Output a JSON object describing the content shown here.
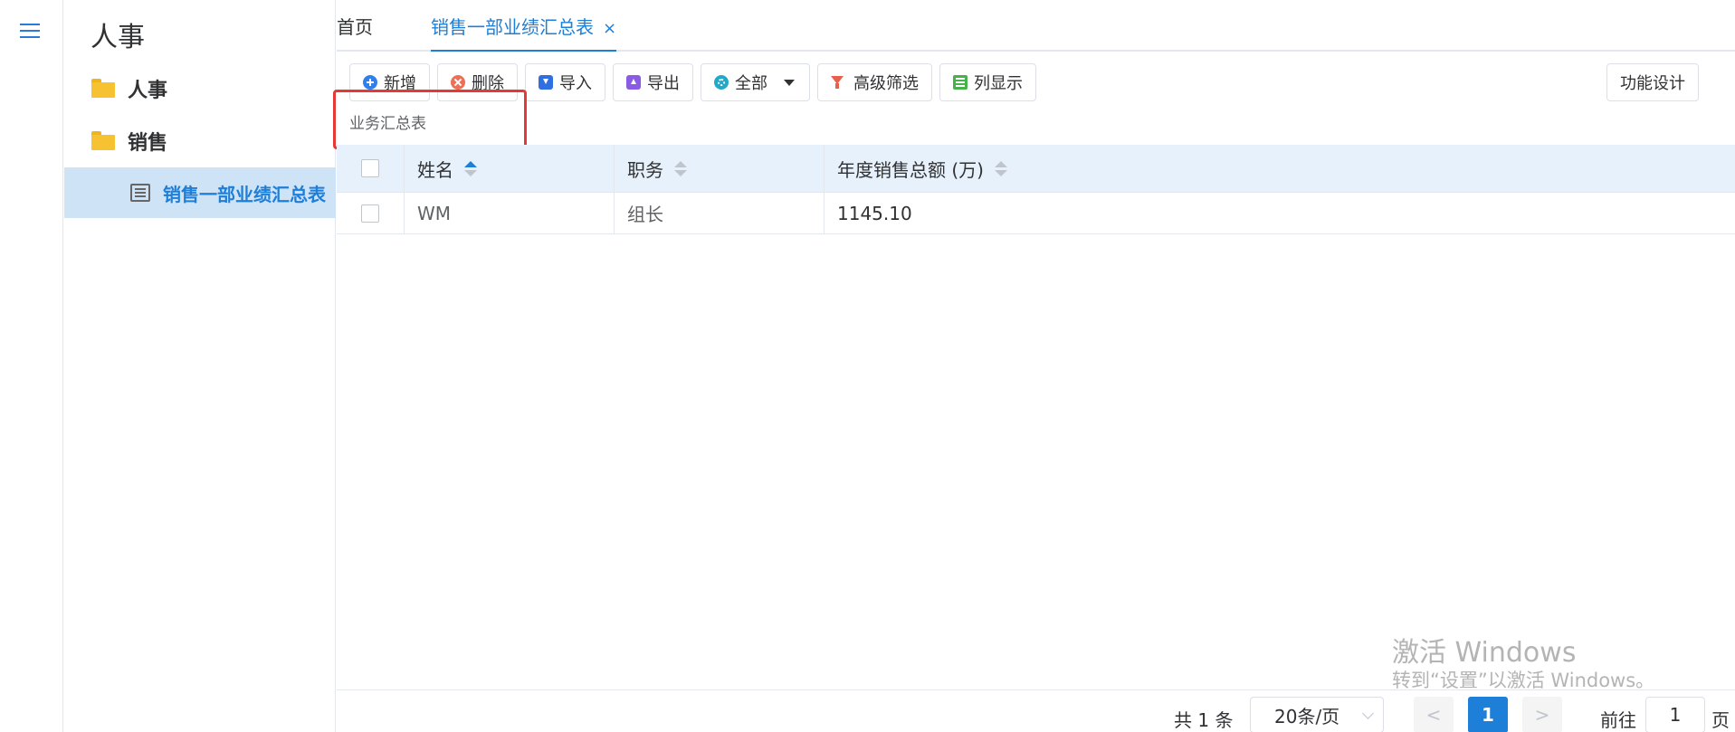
{
  "sidebar": {
    "title": "人事",
    "items": [
      {
        "label": "人事",
        "icon": "folder-icon"
      },
      {
        "label": "销售",
        "icon": "folder-open-icon"
      },
      {
        "label": "销售一部业绩汇总表",
        "icon": "list-icon"
      }
    ]
  },
  "tabs": {
    "home": "首页",
    "active": "销售一部业绩汇总表",
    "close": "×"
  },
  "toolbar": {
    "add": "新增",
    "delete": "删除",
    "import": "导入",
    "export": "导出",
    "all": "全部",
    "advanced_filter": "高级筛选",
    "column_display": "列显示",
    "design": "功能设计"
  },
  "caption": "业务汇总表",
  "table": {
    "headers": [
      "姓名",
      "职务",
      "年度销售总额 (万)"
    ],
    "rows": [
      [
        "WM",
        "组长",
        "1145.10"
      ]
    ]
  },
  "watermark": {
    "line1": "激活 Windows",
    "line2": "转到“设置”以激活 Windows。"
  },
  "pagination": {
    "total": "共 1 条",
    "page_size": "20条/页",
    "current_page": "1",
    "prev": "<",
    "next": ">",
    "goto_label": "前往",
    "goto_value": "1",
    "page_suffix": "页"
  },
  "colors": {
    "accent": "#1e7fd8",
    "highlight_box": "#e53935",
    "active_row": "#cfe3f7",
    "table_header": "#e7f1fb"
  }
}
